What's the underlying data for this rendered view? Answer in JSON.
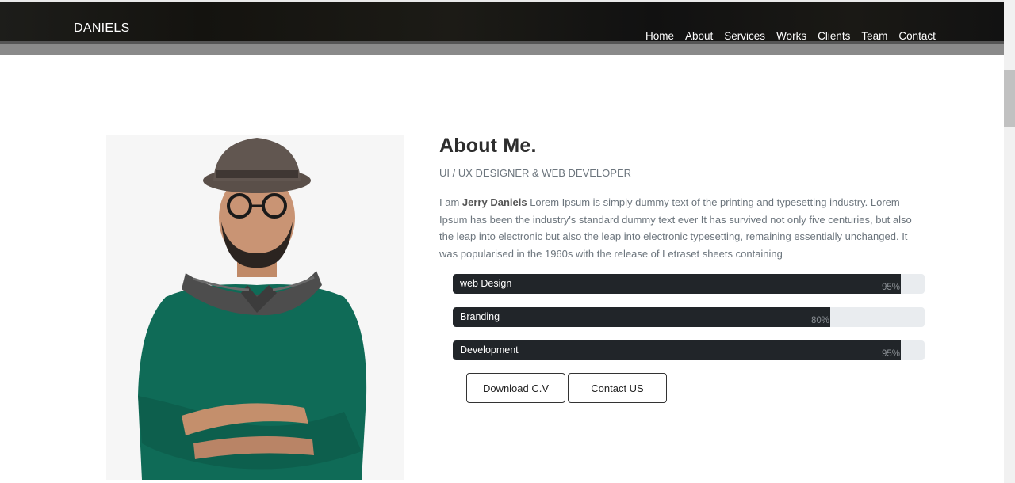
{
  "header": {
    "brand": "DANIELS",
    "nav": [
      "Home",
      "About",
      "Services",
      "Works",
      "Clients",
      "Team",
      "Contact"
    ]
  },
  "about": {
    "title": "About Me.",
    "subtitle": "UI / UX DESIGNER & WEB DEVELOPER",
    "bio_prefix": "I am ",
    "bio_name": "Jerry Daniels",
    "bio_text": " Lorem Ipsum is simply dummy text of the printing and typesetting industry. Lorem Ipsum has been the industry's standard dummy text ever It has survived not only five centuries, but also the leap into electronic but also the leap into electronic typesetting, remaining essentially unchanged. It was popularised in the 1960s with the release of Letraset sheets containing",
    "skills": [
      {
        "label": "web Design",
        "percent": 95,
        "percent_text": "95%"
      },
      {
        "label": "Branding",
        "percent": 80,
        "percent_text": "80%"
      },
      {
        "label": "Development",
        "percent": 95,
        "percent_text": "95%"
      }
    ],
    "download_label": "Download C.V",
    "contact_label": "Contact US"
  },
  "colors": {
    "bar_fill": "#212529",
    "bar_track": "#e9ecef",
    "text_muted": "#6c757d"
  }
}
